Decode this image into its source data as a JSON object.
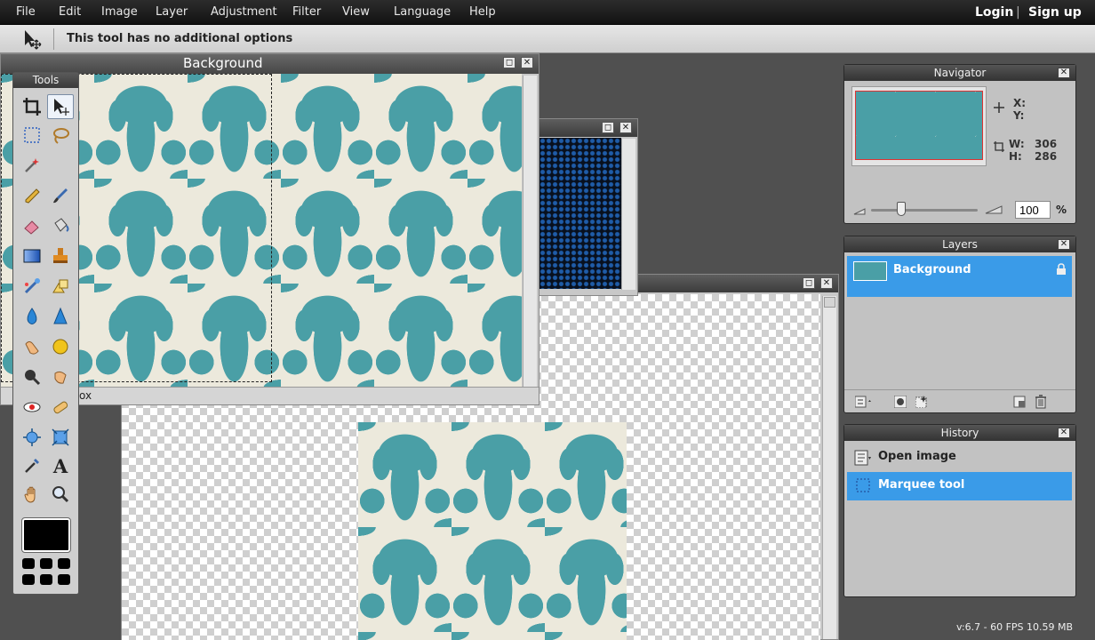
{
  "menubar": {
    "items": [
      "File",
      "Edit",
      "Image",
      "Layer",
      "Adjustment",
      "Filter",
      "View",
      "Language",
      "Help"
    ],
    "login": "Login",
    "separator": "|",
    "signup": "Sign up"
  },
  "optionsbar": {
    "text": "This tool has no additional options",
    "icon": "move-tool-icon"
  },
  "windows": {
    "background": {
      "title": "Background",
      "minimize": "◻",
      "close": "✕",
      "fragment": "ox"
    },
    "dark": {
      "minimize": "◻",
      "close": "✕"
    },
    "transparent": {
      "minimize": "◻",
      "close": "✕"
    }
  },
  "tools": {
    "title": "Tools",
    "foreground_color": "#000000"
  },
  "navigator": {
    "title": "Navigator",
    "close": "✕",
    "x_label": "X:",
    "x_value": "",
    "y_label": "Y:",
    "y_value": "",
    "w_label": "W:",
    "w_value": "306",
    "h_label": "H:",
    "h_value": "286",
    "zoom": "100",
    "zoom_unit": "%",
    "zoom_level": 0.28
  },
  "layers": {
    "title": "Layers",
    "close": "✕",
    "items": [
      {
        "label": "Background",
        "selected": true,
        "locked": true
      }
    ]
  },
  "history": {
    "title": "History",
    "close": "✕",
    "items": [
      {
        "label": "Open image",
        "selected": false
      },
      {
        "label": "Marquee tool",
        "selected": true
      }
    ]
  },
  "status": {
    "text": "v:6.7 - 60 FPS 10.59 MB"
  },
  "colors": {
    "accent": "#3a9be8",
    "pattern_teal": "#4a9fa6",
    "pattern_cream": "#ece9dc"
  }
}
